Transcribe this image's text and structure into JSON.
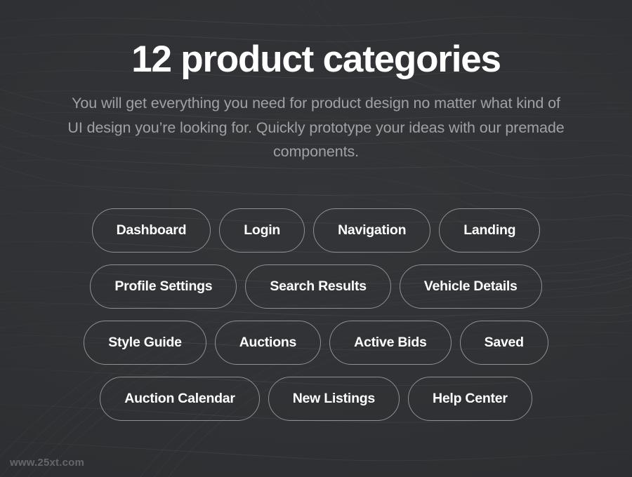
{
  "page": {
    "title": "12 product categories",
    "subtitle": "You will get everything you need for product design no matter what kind of UI design you’re looking for. Quickly prototype your ideas with our premade components.",
    "background_color": "#2e3033",
    "title_color": "#ffffff",
    "subtitle_color": "#9fa1a4",
    "pill_border_color": "#8e9094",
    "pill_label_color": "#ffffff",
    "watermark_color": "#646669"
  },
  "categories": {
    "count": 12,
    "rows": [
      {
        "items": [
          {
            "label": "Dashboard"
          },
          {
            "label": "Login"
          },
          {
            "label": "Navigation"
          },
          {
            "label": "Landing"
          }
        ]
      },
      {
        "items": [
          {
            "label": "Profile Settings"
          },
          {
            "label": "Search Results"
          },
          {
            "label": "Vehicle Details"
          }
        ]
      },
      {
        "items": [
          {
            "label": "Style Guide"
          },
          {
            "label": "Auctions"
          },
          {
            "label": "Active Bids"
          },
          {
            "label": "Saved"
          }
        ]
      },
      {
        "items": [
          {
            "label": "Auction Calendar"
          },
          {
            "label": "New Listings"
          },
          {
            "label": "Help Center"
          }
        ]
      }
    ]
  },
  "watermark": {
    "text": "www.25xt.com"
  }
}
